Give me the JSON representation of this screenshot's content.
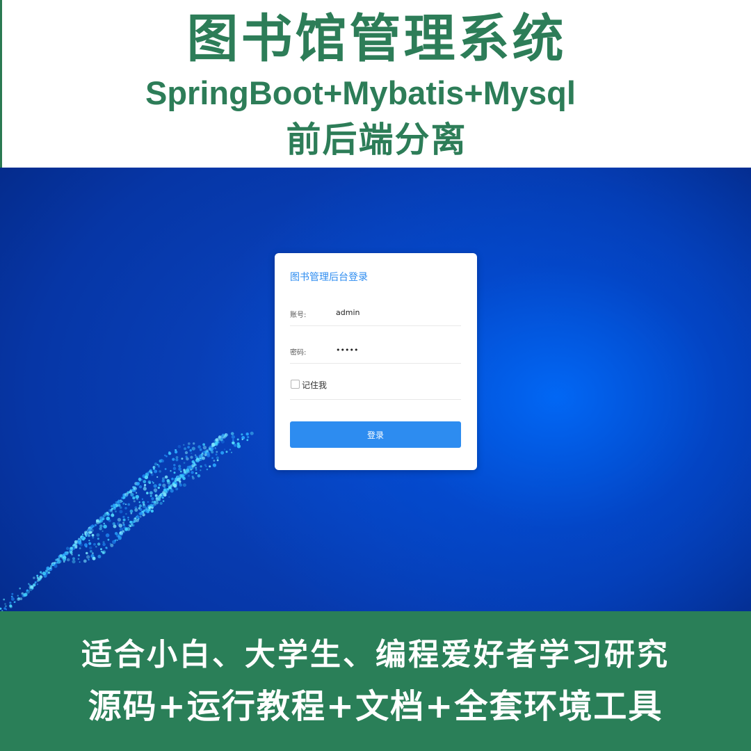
{
  "banner": {
    "title": "图书馆管理系统",
    "stack": "SpringBoot+Mybatis+Mysql",
    "subtitle": "前后端分离"
  },
  "login": {
    "title": "图书管理后台登录",
    "account_label": "账号:",
    "account_value": "admin",
    "password_label": "密码:",
    "password_value": "•••••",
    "remember_label": "记住我",
    "remember_checked": false,
    "submit_label": "登录"
  },
  "footer": {
    "line1": "适合小白、大学生、编程爱好者学习研究",
    "line2": "源码+运行教程+文档+全套环境工具"
  },
  "colors": {
    "brand_green": "#2d7d58",
    "footer_green": "#2a7f58",
    "button_blue": "#2d8cf0",
    "background_blue": "#0a48c8"
  }
}
